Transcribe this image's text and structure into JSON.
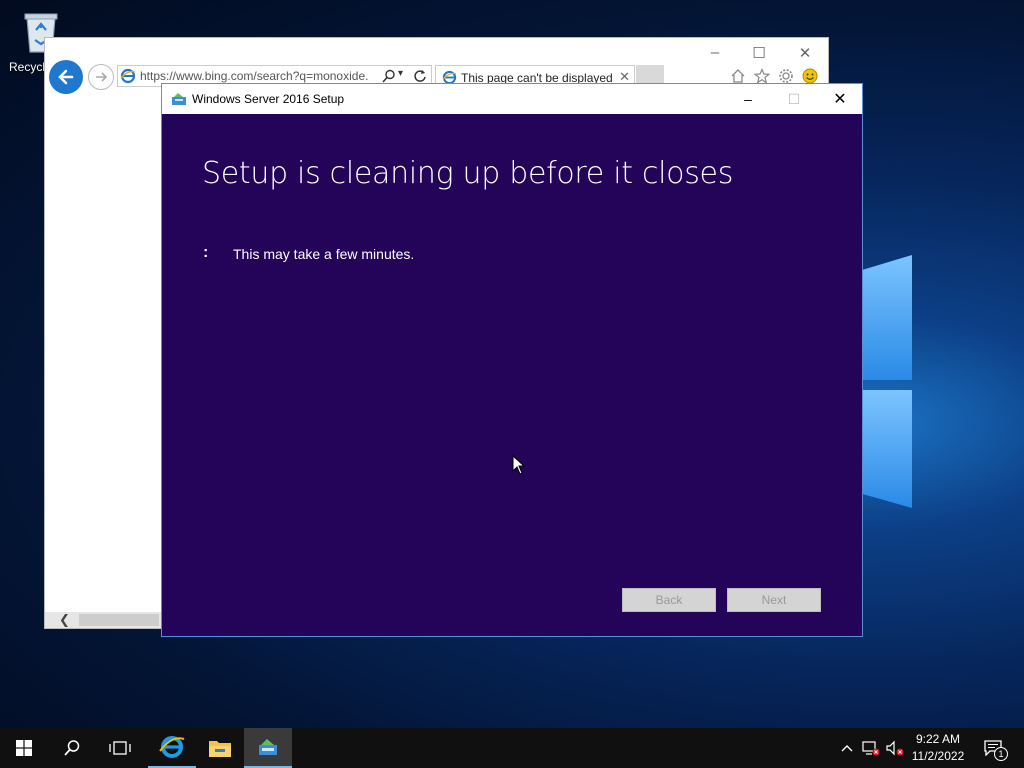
{
  "desktop": {
    "recycle_bin_label": "Recycl"
  },
  "ie_window": {
    "address": "https://www.bing.com/search?q=monoxide.",
    "tab_title": "This page can't be displayed",
    "controls": [
      "minimize-icon",
      "maximize-icon",
      "close-icon"
    ],
    "toolbar_icons": [
      "home-icon",
      "favorites-star-icon",
      "gear-icon",
      "smiley-feedback-icon"
    ]
  },
  "setup_dialog": {
    "title": "Windows Server 2016 Setup",
    "heading": "Setup is cleaning up before it closes",
    "progress_marker": ":",
    "message": "This may take a few minutes.",
    "back_label": "Back",
    "next_label": "Next",
    "buttons_enabled": false,
    "background_color": "#230458"
  },
  "taskbar": {
    "start_icon": "windows-start-icon",
    "search_icon": "search-icon",
    "task_view_icon": "task-view-icon",
    "pinned": [
      "internet-explorer-icon",
      "file-explorer-icon",
      "setup-icon"
    ],
    "active_app": "setup-icon",
    "tray_icons": [
      "chevron-up-icon",
      "network-disconnected-icon",
      "volume-muted-icon"
    ],
    "time": "9:22 AM",
    "date": "11/2/2022",
    "notification_count": "1",
    "accent_color": "#76b9ed"
  }
}
